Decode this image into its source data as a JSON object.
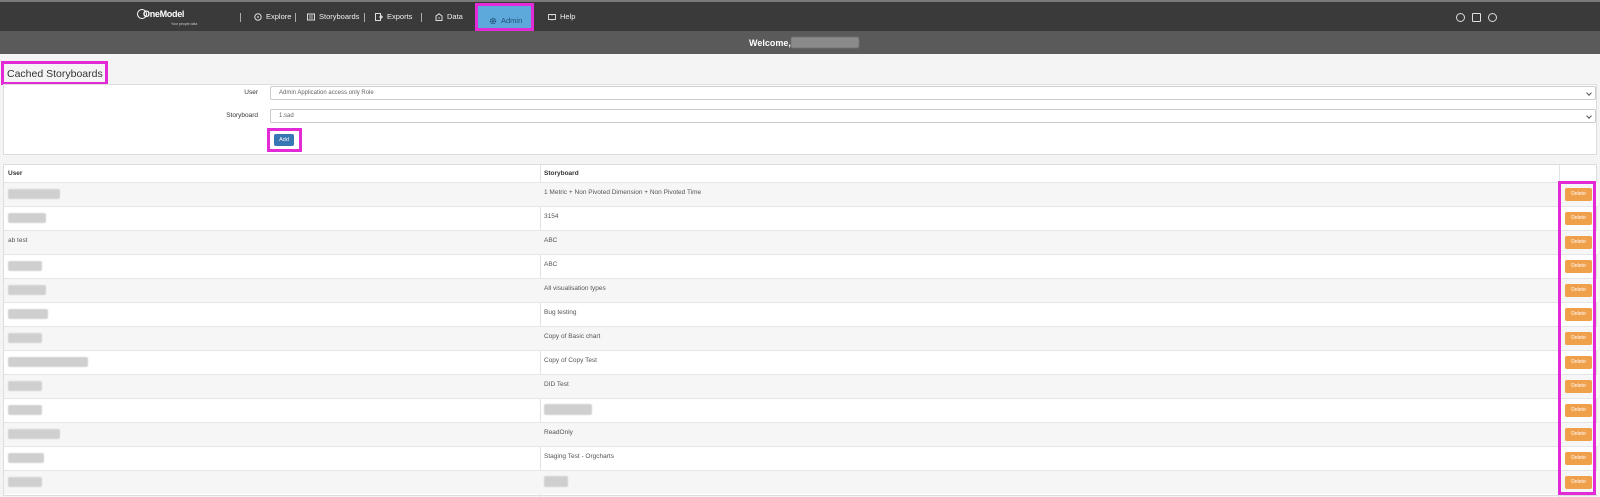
{
  "app": {
    "logo_text": "OneModel",
    "logo_tagline": "Your people data"
  },
  "nav": {
    "items": [
      {
        "label": "Explore",
        "icon": "compass-icon"
      },
      {
        "label": "Storyboards",
        "icon": "storyboard-icon"
      },
      {
        "label": "Exports",
        "icon": "export-icon"
      },
      {
        "label": "Data",
        "icon": "data-icon"
      },
      {
        "label": "Admin",
        "icon": "gear-icon"
      },
      {
        "label": "Help",
        "icon": "book-icon"
      }
    ],
    "active": "Admin",
    "right_icons": [
      "people-icon",
      "window-icon",
      "user-icon"
    ]
  },
  "welcome": {
    "text": "Welcome,"
  },
  "page": {
    "title": "Cached Storyboards"
  },
  "form": {
    "user_label": "User",
    "user_value": "Admin Application access only Role",
    "storyboard_label": "Storyboard",
    "storyboard_value": "1.sad",
    "add_label": "Add"
  },
  "table": {
    "headers": {
      "user": "User",
      "storyboard": "Storyboard"
    },
    "delete_label": "Delete",
    "rows": [
      {
        "user": "",
        "storyboard": "1 Metric + Non Pivoted Dimension + Non Pivoted Time"
      },
      {
        "user": "",
        "storyboard": "3154"
      },
      {
        "user": "ab test",
        "storyboard": "ABC"
      },
      {
        "user": "",
        "storyboard": "ABC"
      },
      {
        "user": "",
        "storyboard": "All visualisation types"
      },
      {
        "user": "",
        "storyboard": "Bug testing"
      },
      {
        "user": "",
        "storyboard": "Copy of Basic chart"
      },
      {
        "user": "",
        "storyboard": "Copy of Copy Test"
      },
      {
        "user": "",
        "storyboard": "DID Test"
      },
      {
        "user": "",
        "storyboard": ""
      },
      {
        "user": "",
        "storyboard": "ReadOnly"
      },
      {
        "user": "",
        "storyboard": "Staging Test - Orgcharts"
      },
      {
        "user": "",
        "storyboard": ""
      }
    ]
  },
  "colors": {
    "highlight": "#e22bd6",
    "delete": "#f0a04b",
    "add": "#3777b3",
    "topbar": "#3a3a3a"
  }
}
